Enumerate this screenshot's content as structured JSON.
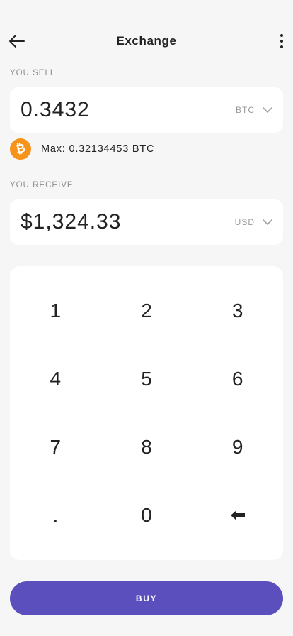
{
  "header": {
    "title": "Exchange",
    "back_icon": "arrow-left-icon",
    "more_icon": "more-vertical-icon"
  },
  "sell": {
    "label": "YOU SELL",
    "amount": "0.3432",
    "currency": "BTC",
    "max_text": "Max: 0.32134453 BTC",
    "coin_icon": "bitcoin-icon",
    "coin_glyph": "₿",
    "coin_color": "#f7931a"
  },
  "receive": {
    "label": "YOU RECEIVE",
    "amount": "$1,324.33",
    "currency": "USD"
  },
  "keypad": {
    "keys": [
      "1",
      "2",
      "3",
      "4",
      "5",
      "6",
      "7",
      "8",
      "9",
      ".",
      "0",
      "⬅"
    ]
  },
  "buy_button": {
    "label": "BUY",
    "color": "#5b4fbe"
  }
}
